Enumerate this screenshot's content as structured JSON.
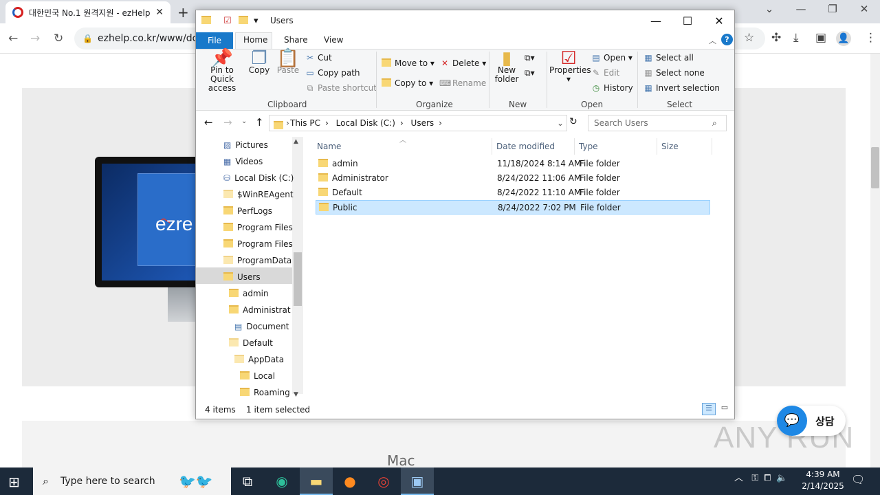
{
  "browser": {
    "tab_title": "대한민국 No.1 원격지원 - ezHelp",
    "url": "ezhelp.co.kr/www/down",
    "new_tab": "+",
    "tab_close": "✕"
  },
  "page": {
    "logo_text": "ezre",
    "mac_label": "Mac",
    "chat_label": "상담",
    "watermark": "ANY RUN"
  },
  "explorer": {
    "title": "Users",
    "tabs": {
      "file": "File",
      "home": "Home",
      "share": "Share",
      "view": "View"
    },
    "clipboard": {
      "pin": "Pin to Quick access",
      "copy": "Copy",
      "paste": "Paste",
      "cut": "Cut",
      "copy_path": "Copy path",
      "paste_shortcut": "Paste shortcut",
      "label": "Clipboard"
    },
    "organize": {
      "move_to": "Move to",
      "copy_to": "Copy to",
      "delete": "Delete",
      "rename": "Rename",
      "label": "Organize"
    },
    "new": {
      "new_folder_1": "New",
      "new_folder_2": "folder",
      "label": "New"
    },
    "open": {
      "properties": "Properties",
      "open": "Open",
      "edit": "Edit",
      "history": "History",
      "label": "Open"
    },
    "select": {
      "select_all": "Select all",
      "select_none": "Select none",
      "invert": "Invert selection",
      "label": "Select"
    },
    "address": {
      "crumbs": [
        "This PC",
        "Local Disk (C:)",
        "Users"
      ]
    },
    "search_placeholder": "Search Users",
    "nav": [
      {
        "label": "Pictures",
        "indent": 0
      },
      {
        "label": "Videos",
        "indent": 0
      },
      {
        "label": "Local Disk (C:)",
        "indent": 0
      },
      {
        "label": "$WinREAgent",
        "indent": 1
      },
      {
        "label": "PerfLogs",
        "indent": 1
      },
      {
        "label": "Program Files",
        "indent": 1
      },
      {
        "label": "Program Files",
        "indent": 1
      },
      {
        "label": "ProgramData",
        "indent": 1
      },
      {
        "label": "Users",
        "indent": 1
      },
      {
        "label": "admin",
        "indent": 2
      },
      {
        "label": "Administrat",
        "indent": 2
      },
      {
        "label": "Document",
        "indent": 3
      },
      {
        "label": "Default",
        "indent": 2
      },
      {
        "label": "AppData",
        "indent": 3
      },
      {
        "label": "Local",
        "indent": 4
      },
      {
        "label": "Roaming",
        "indent": 4
      }
    ],
    "columns": {
      "name": "Name",
      "date": "Date modified",
      "type": "Type",
      "size": "Size"
    },
    "files": [
      {
        "name": "admin",
        "date": "11/18/2024 8:14 AM",
        "type": "File folder",
        "selected": false
      },
      {
        "name": "Administrator",
        "date": "8/24/2022 11:06 AM",
        "type": "File folder",
        "selected": false
      },
      {
        "name": "Default",
        "date": "8/24/2022 11:10 AM",
        "type": "File folder",
        "selected": false
      },
      {
        "name": "Public",
        "date": "8/24/2022 7:02 PM",
        "type": "File folder",
        "selected": true
      }
    ],
    "status": {
      "items": "4 items",
      "selected": "1 item selected"
    }
  },
  "taskbar": {
    "search_placeholder": "Type here to search",
    "time": "4:39 AM",
    "date": "2/14/2025"
  },
  "colors": {
    "accent": "#1979ca",
    "selection": "#cce8ff",
    "taskbar": "#1c2a3a"
  }
}
